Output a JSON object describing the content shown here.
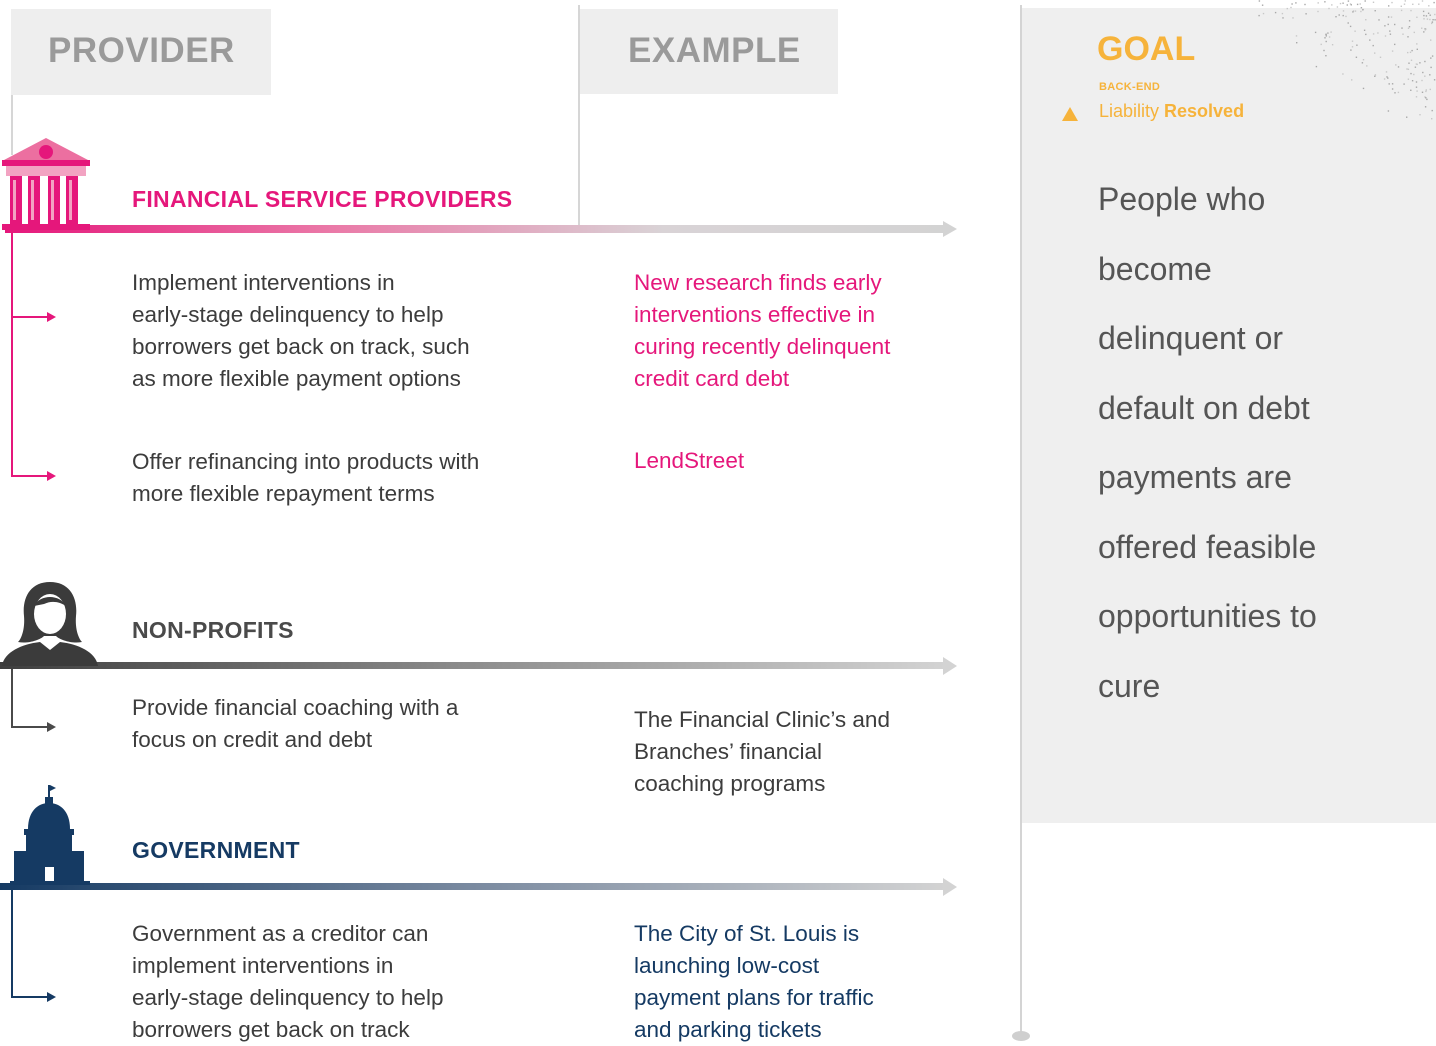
{
  "headers": {
    "provider": "PROVIDER",
    "example": "EXAMPLE"
  },
  "sections": [
    {
      "title": "FINANCIAL SERVICE PROVIDERS",
      "icon": "bank-icon",
      "color": "#e5177b",
      "items": [
        {
          "action": "Implement interventions in early-stage delinquency to help borrowers get back on track, such as more flexible payment options",
          "action_lines": [
            "Implement interventions in",
            "early-stage delinquency to help",
            "borrowers get back on track, such",
            "as more flexible payment options"
          ],
          "example_lines": [
            "New research finds early",
            "interventions effective in",
            "curing recently delinquent",
            "credit card debt"
          ]
        },
        {
          "action_lines": [
            "Offer refinancing into products with",
            "more flexible repayment terms"
          ],
          "example_lines": [
            "LendStreet"
          ]
        }
      ]
    },
    {
      "title": "NON-PROFITS",
      "icon": "person-icon",
      "color": "#4a4a4a",
      "items": [
        {
          "action_lines": [
            "Provide financial coaching with a",
            "focus on credit and debt"
          ],
          "example_lines": [
            "The Financial Clinic’s and",
            "Branches’ financial",
            "coaching programs"
          ]
        }
      ]
    },
    {
      "title": "GOVERNMENT",
      "icon": "capitol-icon",
      "color": "#153a63",
      "items": [
        {
          "action_lines": [
            "Government as a creditor can",
            "implement interventions in",
            "early-stage delinquency to help",
            "borrowers get back on track"
          ],
          "example_lines": [
            "The City of St. Louis is",
            "launching low-cost",
            "payment plans for traffic",
            "and parking tickets"
          ]
        }
      ]
    }
  ],
  "goal": {
    "title": "GOAL",
    "subtitle": "BACK-END",
    "liability_prefix": "Liability ",
    "liability_status": "Resolved",
    "body_lines": [
      "People who",
      "become",
      "delinquent or",
      "default on debt",
      "payments are",
      "offered feasible",
      "opportunities to",
      "cure"
    ],
    "accent": "#f6b33b"
  },
  "colors": {
    "header_bg": "#eeeeee",
    "header_text": "#9a9a9a",
    "pink": "#e5177b",
    "dark": "#4a4a4a",
    "navy": "#153a63",
    "goal_bg": "#efefef"
  }
}
